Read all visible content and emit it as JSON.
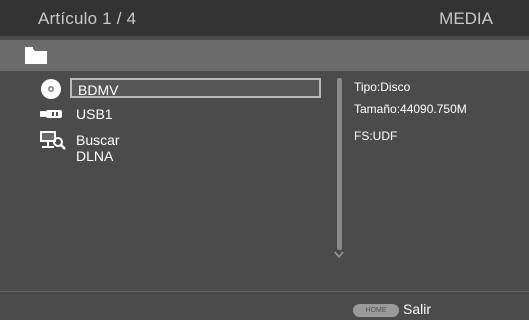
{
  "header": {
    "counter": "Artículo 1 / 4",
    "title": "MEDIA"
  },
  "path_bar": {
    "icon": "folder-icon"
  },
  "devices": [
    {
      "label": "BDMV",
      "icon": "disc-icon",
      "selected": true
    },
    {
      "label": "USB1",
      "icon": "usb-icon",
      "selected": false
    },
    {
      "label": "Buscar DLNA",
      "icon": "dlna-search-icon",
      "selected": false
    }
  ],
  "info": {
    "type": "Tipo:Disco",
    "size": "Tamaño:44090.750M",
    "fs": "FS:UDF"
  },
  "footer": {
    "home_key": "HOME",
    "home_label": "Salir"
  },
  "colors": {
    "background": "#4b4b4b",
    "title_bar": "#333333",
    "path_bar": "#6b6b6b",
    "text": "#ffffff",
    "muted_text": "#c9c9c9"
  }
}
